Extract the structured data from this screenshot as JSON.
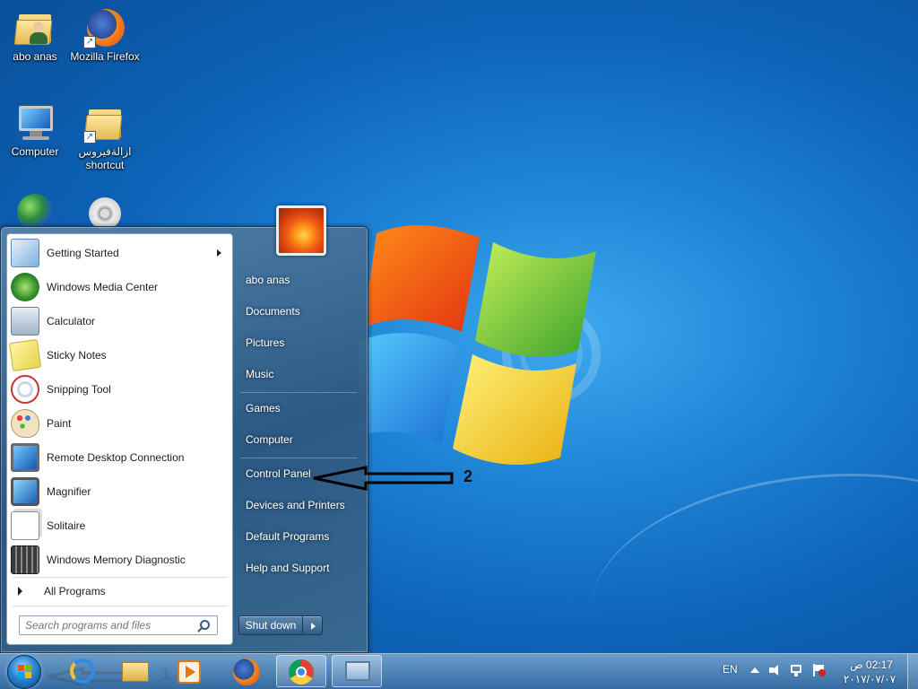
{
  "desktop": {
    "icons": [
      {
        "label": "abo anas",
        "icon": "user-folder-icon"
      },
      {
        "label": "Mozilla Firefox",
        "icon": "firefox-icon"
      },
      {
        "label": "Computer",
        "icon": "computer-icon"
      },
      {
        "label": "ازالةفيروس shortcut",
        "icon": "folder-shortcut-icon"
      },
      {
        "label": "",
        "icon": "network-icon"
      },
      {
        "label": "",
        "icon": "media-icon"
      }
    ]
  },
  "start_menu": {
    "programs": [
      {
        "label": "Getting Started",
        "icon": "getting-started-icon",
        "has_submenu": true
      },
      {
        "label": "Windows Media Center",
        "icon": "media-center-icon"
      },
      {
        "label": "Calculator",
        "icon": "calculator-icon"
      },
      {
        "label": "Sticky Notes",
        "icon": "sticky-notes-icon"
      },
      {
        "label": "Snipping Tool",
        "icon": "snipping-tool-icon"
      },
      {
        "label": "Paint",
        "icon": "paint-icon"
      },
      {
        "label": "Remote Desktop Connection",
        "icon": "remote-desktop-icon"
      },
      {
        "label": "Magnifier",
        "icon": "magnifier-icon"
      },
      {
        "label": "Solitaire",
        "icon": "solitaire-icon"
      },
      {
        "label": "Windows Memory Diagnostic",
        "icon": "memory-diagnostic-icon"
      }
    ],
    "all_programs": "All Programs",
    "search_placeholder": "Search programs and files",
    "right_links": [
      "abo anas",
      "Documents",
      "Pictures",
      "Music",
      "Games",
      "Computer",
      "Control Panel",
      "Devices and Printers",
      "Default Programs",
      "Help and Support"
    ],
    "shutdown_label": "Shut down"
  },
  "annotations": {
    "num1": "1",
    "num2": "2"
  },
  "taskbar": {
    "pinned": [
      "internet-explorer-icon",
      "explorer-folder-icon",
      "media-player-icon",
      "firefox-icon",
      "chrome-icon",
      "control-panel-icon"
    ],
    "language": "EN",
    "time": "02:17 ص",
    "date": "٢٠١٧/٠٧/٠٧"
  },
  "colors": {
    "desktop_bg": "#1f86d8",
    "start_menu_bg": "#2d567e",
    "taskbar": "#3c6ea0"
  }
}
